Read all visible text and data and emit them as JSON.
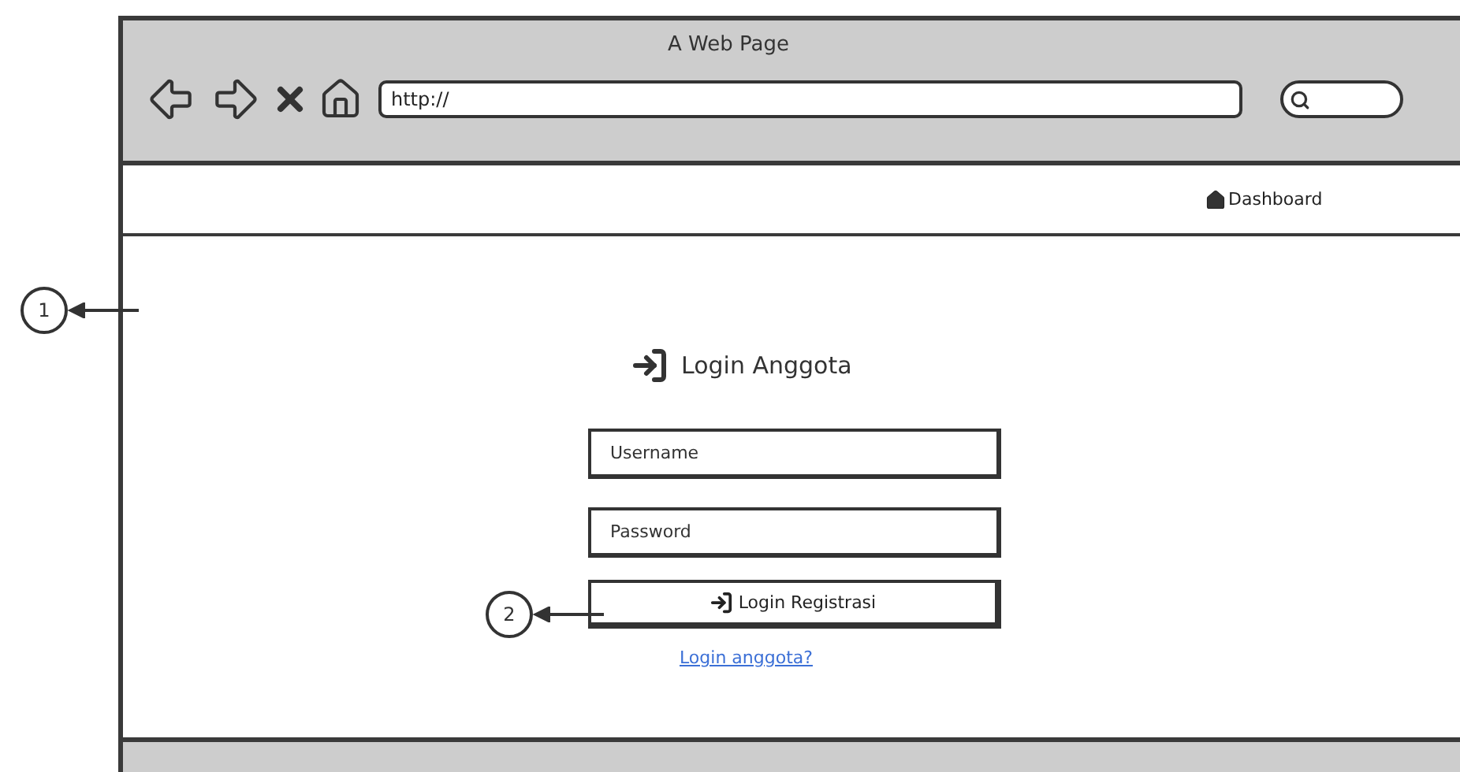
{
  "window": {
    "title": "A Web Page",
    "address": "http://"
  },
  "nav": {
    "link": "Dashboard"
  },
  "login": {
    "heading": "Login Anggota",
    "fields": [
      {
        "placeholder": "Username"
      },
      {
        "placeholder": "Password"
      }
    ],
    "button": "Login Registrasi",
    "link": "Login anggota?"
  },
  "callouts": [
    {
      "label": "1"
    },
    {
      "label": "2"
    }
  ]
}
